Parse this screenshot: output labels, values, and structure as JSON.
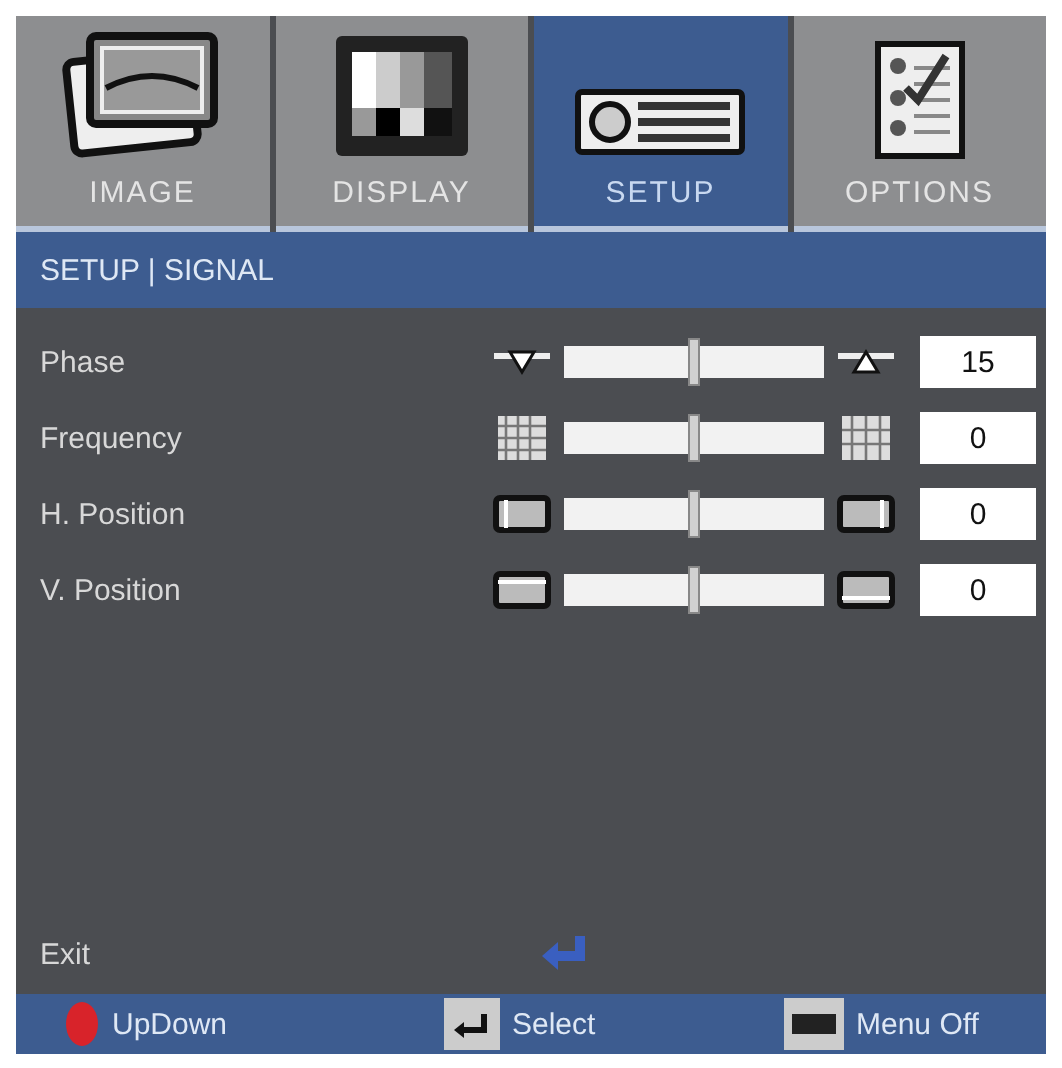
{
  "tabs": [
    {
      "label": "IMAGE",
      "kind": "image",
      "selected": false
    },
    {
      "label": "DISPLAY",
      "kind": "display",
      "selected": false
    },
    {
      "label": "SETUP",
      "kind": "setup",
      "selected": true
    },
    {
      "label": "OPTIONS",
      "kind": "options",
      "selected": false
    }
  ],
  "breadcrumb": "SETUP | SIGNAL",
  "settings": [
    {
      "label": "Phase",
      "kind": "phase",
      "level": 0.5,
      "value": "15"
    },
    {
      "label": "Frequency",
      "kind": "frequency",
      "level": 0.5,
      "value": "0"
    },
    {
      "label": "H. Position",
      "kind": "hpos",
      "level": 0.5,
      "value": "0"
    },
    {
      "label": "V. Position",
      "kind": "vpos",
      "level": 0.5,
      "value": "0"
    }
  ],
  "exit": {
    "label": "Exit"
  },
  "footer": [
    {
      "kind": "updown",
      "label": "UpDown"
    },
    {
      "kind": "enter",
      "label": "Select"
    },
    {
      "kind": "menu",
      "label": "Menu Off"
    }
  ]
}
